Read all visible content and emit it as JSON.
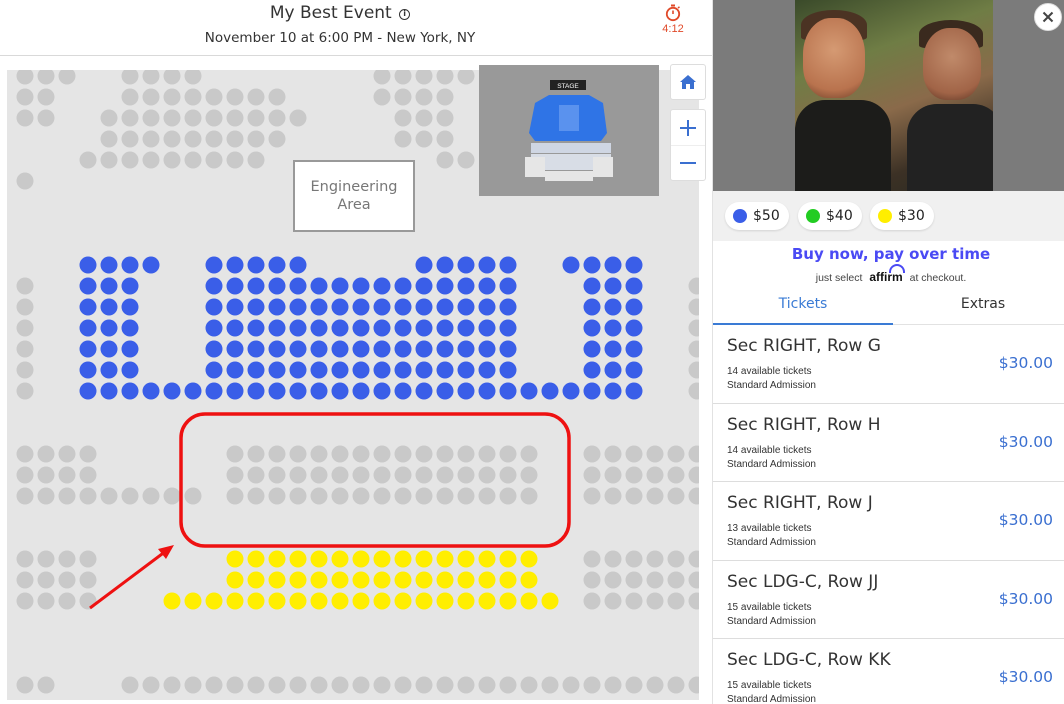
{
  "header": {
    "title": "My Best Event",
    "subtitle": "November 10 at 6:00 PM - New York, NY",
    "timer": "4:12",
    "icons": {
      "info": "info-icon",
      "timer": "stopwatch-icon"
    }
  },
  "map": {
    "area_label_line1": "Engineering",
    "area_label_line2": "Area",
    "minimap_stage_label": "STAGE",
    "controls": {
      "home": "home-icon",
      "zoom_in": "plus-icon",
      "zoom_out": "minus-icon"
    }
  },
  "colors": {
    "accent_blue": "#3a6fd0",
    "seat_50": "#3a5ee8",
    "seat_40": "#22cc22",
    "seat_30": "#ffee00",
    "seat_unavailable": "#c9c9c9",
    "annotation": "#ee1111"
  },
  "legend": [
    {
      "label": "$50",
      "color": "#3a5ee8"
    },
    {
      "label": "$40",
      "color": "#22cc22"
    },
    {
      "label": "$30",
      "color": "#ffee00"
    }
  ],
  "affirm": {
    "title": "Buy now, pay over time",
    "pre": "just select",
    "brand": "affirm",
    "post": "at checkout."
  },
  "tabs": [
    {
      "label": "Tickets",
      "active": true
    },
    {
      "label": "Extras",
      "active": false
    }
  ],
  "tickets": [
    {
      "title": "Sec RIGHT, Row G",
      "available": "14 available tickets",
      "admission": "Standard Admission",
      "price": "$30.00"
    },
    {
      "title": "Sec RIGHT, Row H",
      "available": "14 available tickets",
      "admission": "Standard Admission",
      "price": "$30.00"
    },
    {
      "title": "Sec RIGHT, Row J",
      "available": "13 available tickets",
      "admission": "Standard Admission",
      "price": "$30.00"
    },
    {
      "title": "Sec LDG-C, Row JJ",
      "available": "15 available tickets",
      "admission": "Standard Admission",
      "price": "$30.00"
    },
    {
      "title": "Sec LDG-C, Row KK",
      "available": "15 available tickets",
      "admission": "Standard Admission",
      "price": "$30.00"
    }
  ],
  "close_icon": "close-icon"
}
